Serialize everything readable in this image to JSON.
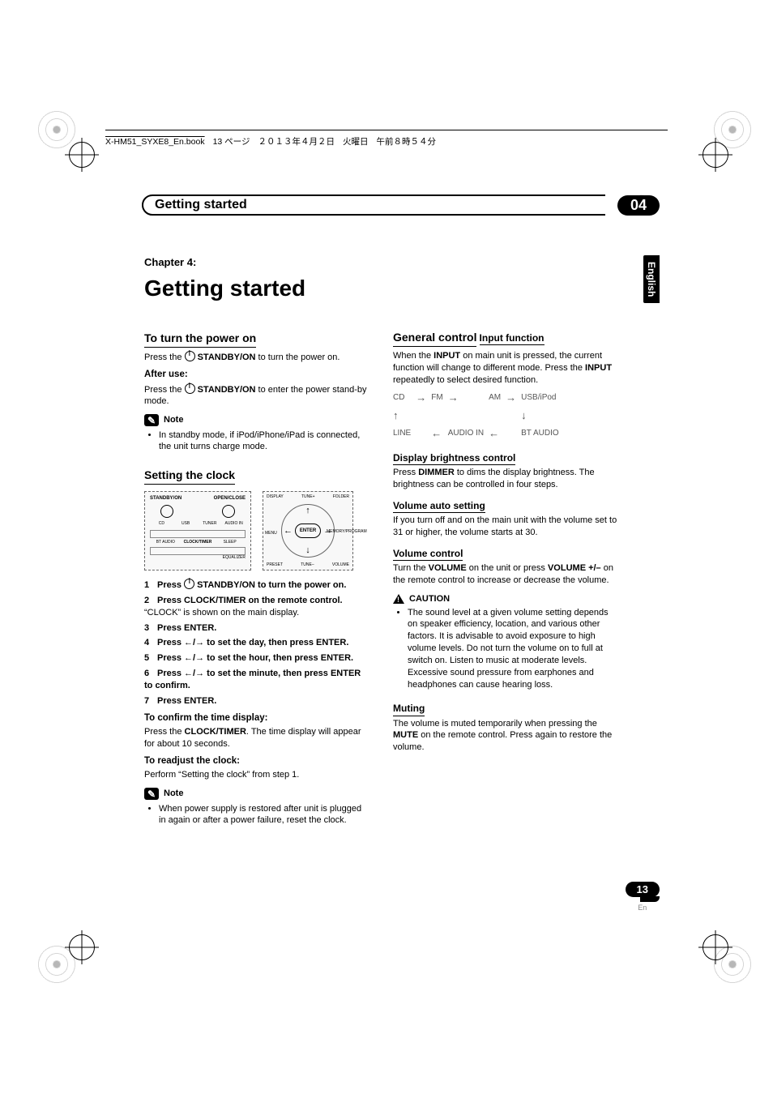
{
  "header": {
    "file": "X-HM51_SYXE8_En.book",
    "page_text": "13 ページ",
    "date": "２０１３年４月２日",
    "day": "火曜日",
    "time": "午前８時５４分"
  },
  "section": {
    "title": "Getting started",
    "number": "04"
  },
  "lang_tab": "English",
  "chapter": {
    "kicker": "Chapter 4:",
    "title": "Getting started"
  },
  "left": {
    "power_h": "To turn the power on",
    "power_p1a": "Press the ",
    "power_p1b": " STANDBY/ON",
    "power_p1c": " to turn the power on.",
    "after_use_h": "After use:",
    "after_use_a": "Press the ",
    "after_use_b": " STANDBY/ON",
    "after_use_c": " to enter the power stand-by mode.",
    "note_label": "Note",
    "note_power": "In standby mode, if iPod/iPhone/iPad is connected, the unit turns charge mode.",
    "clock_h": "Setting the clock",
    "remote_labels": {
      "standby": "STANDBY/ON",
      "open": "OPEN/CLOSE",
      "cd": "CD",
      "usb": "USB",
      "tuner": "TUNER",
      "audioin": "AUDIO IN",
      "bt": "BT AUDIO",
      "clocktimer": "CLOCK/TIMER",
      "sleep": "SLEEP",
      "equalizer": "EQUALIZER",
      "display": "DISPLAY",
      "tunep": "TUNE+",
      "tunem": "TUNE–",
      "folder": "FOLDER",
      "enter": "ENTER",
      "menu": "MENU",
      "memory": "MEMORY/PROGRAM",
      "preset": "PRESET",
      "volume": "VOLUME"
    },
    "steps": [
      {
        "n": "1",
        "b": "Press ",
        "b2": " STANDBY/ON to turn the power on.",
        "pwr": true
      },
      {
        "n": "2",
        "b": "Press CLOCK/TIMER on the remote control.",
        "t": "“CLOCK” is shown on the main display."
      },
      {
        "n": "3",
        "b": "Press ENTER."
      },
      {
        "n": "4",
        "b": "Press ",
        "arrows": true,
        "b2": " to set the day, then press ENTER."
      },
      {
        "n": "5",
        "b": "Press ",
        "arrows": true,
        "b2": " to set the hour, then press ENTER."
      },
      {
        "n": "6",
        "b": "Press ",
        "arrows": true,
        "b2": " to set the minute, then press ENTER to confirm."
      },
      {
        "n": "7",
        "b": "Press ENTER."
      }
    ],
    "confirm_h": "To confirm the time display:",
    "confirm_a": "Press the ",
    "confirm_b": "CLOCK/TIMER",
    "confirm_c": ". The time display will appear for about 10 seconds.",
    "readjust_h": "To readjust the clock:",
    "readjust_p": "Perform “Setting the clock” from step 1.",
    "note_clock": "When power supply is restored after unit is plugged in again or after a power failure, reset the clock."
  },
  "right": {
    "h": "General control",
    "input_h": "Input function",
    "input_p_a": "When the ",
    "input_p_b": "INPUT",
    "input_p_c": " on main unit is pressed, the current function will change to different mode. Press the ",
    "input_p_d": "INPUT",
    "input_p_e": " repeatedly to select desired function.",
    "cycle": [
      "CD",
      "FM",
      "AM",
      "USB/iPod",
      "BT AUDIO",
      "AUDIO IN",
      "LINE"
    ],
    "bright_h": "Display brightness control",
    "bright_a": "Press ",
    "bright_b": "DIMMER",
    "bright_c": " to dims the display brightness. The brightness can be controlled in four steps.",
    "auto_h": "Volume auto setting",
    "auto_p": "If you turn off and on the main unit with the volume set to 31 or higher, the volume starts at 30.",
    "vol_h": "Volume control",
    "vol_a": "Turn the ",
    "vol_b": "VOLUME",
    "vol_c": " on the unit or press ",
    "vol_d": "VOLUME +/–",
    "vol_e": " on the remote control to increase or decrease the volume.",
    "caution_label": "CAUTION",
    "caution": "The sound level at a given volume setting depends on speaker efficiency, location, and various other factors. It is advisable to avoid exposure to high volume levels. Do not turn the volume on to full at switch on. Listen to music at moderate levels. Excessive sound pressure from earphones and headphones can cause hearing loss.",
    "mute_h": "Muting",
    "mute_a": "The volume is muted temporarily when pressing the ",
    "mute_b": "MUTE",
    "mute_c": " on the remote control. Press again to restore the volume."
  },
  "footer": {
    "page": "13",
    "lang": "En"
  }
}
